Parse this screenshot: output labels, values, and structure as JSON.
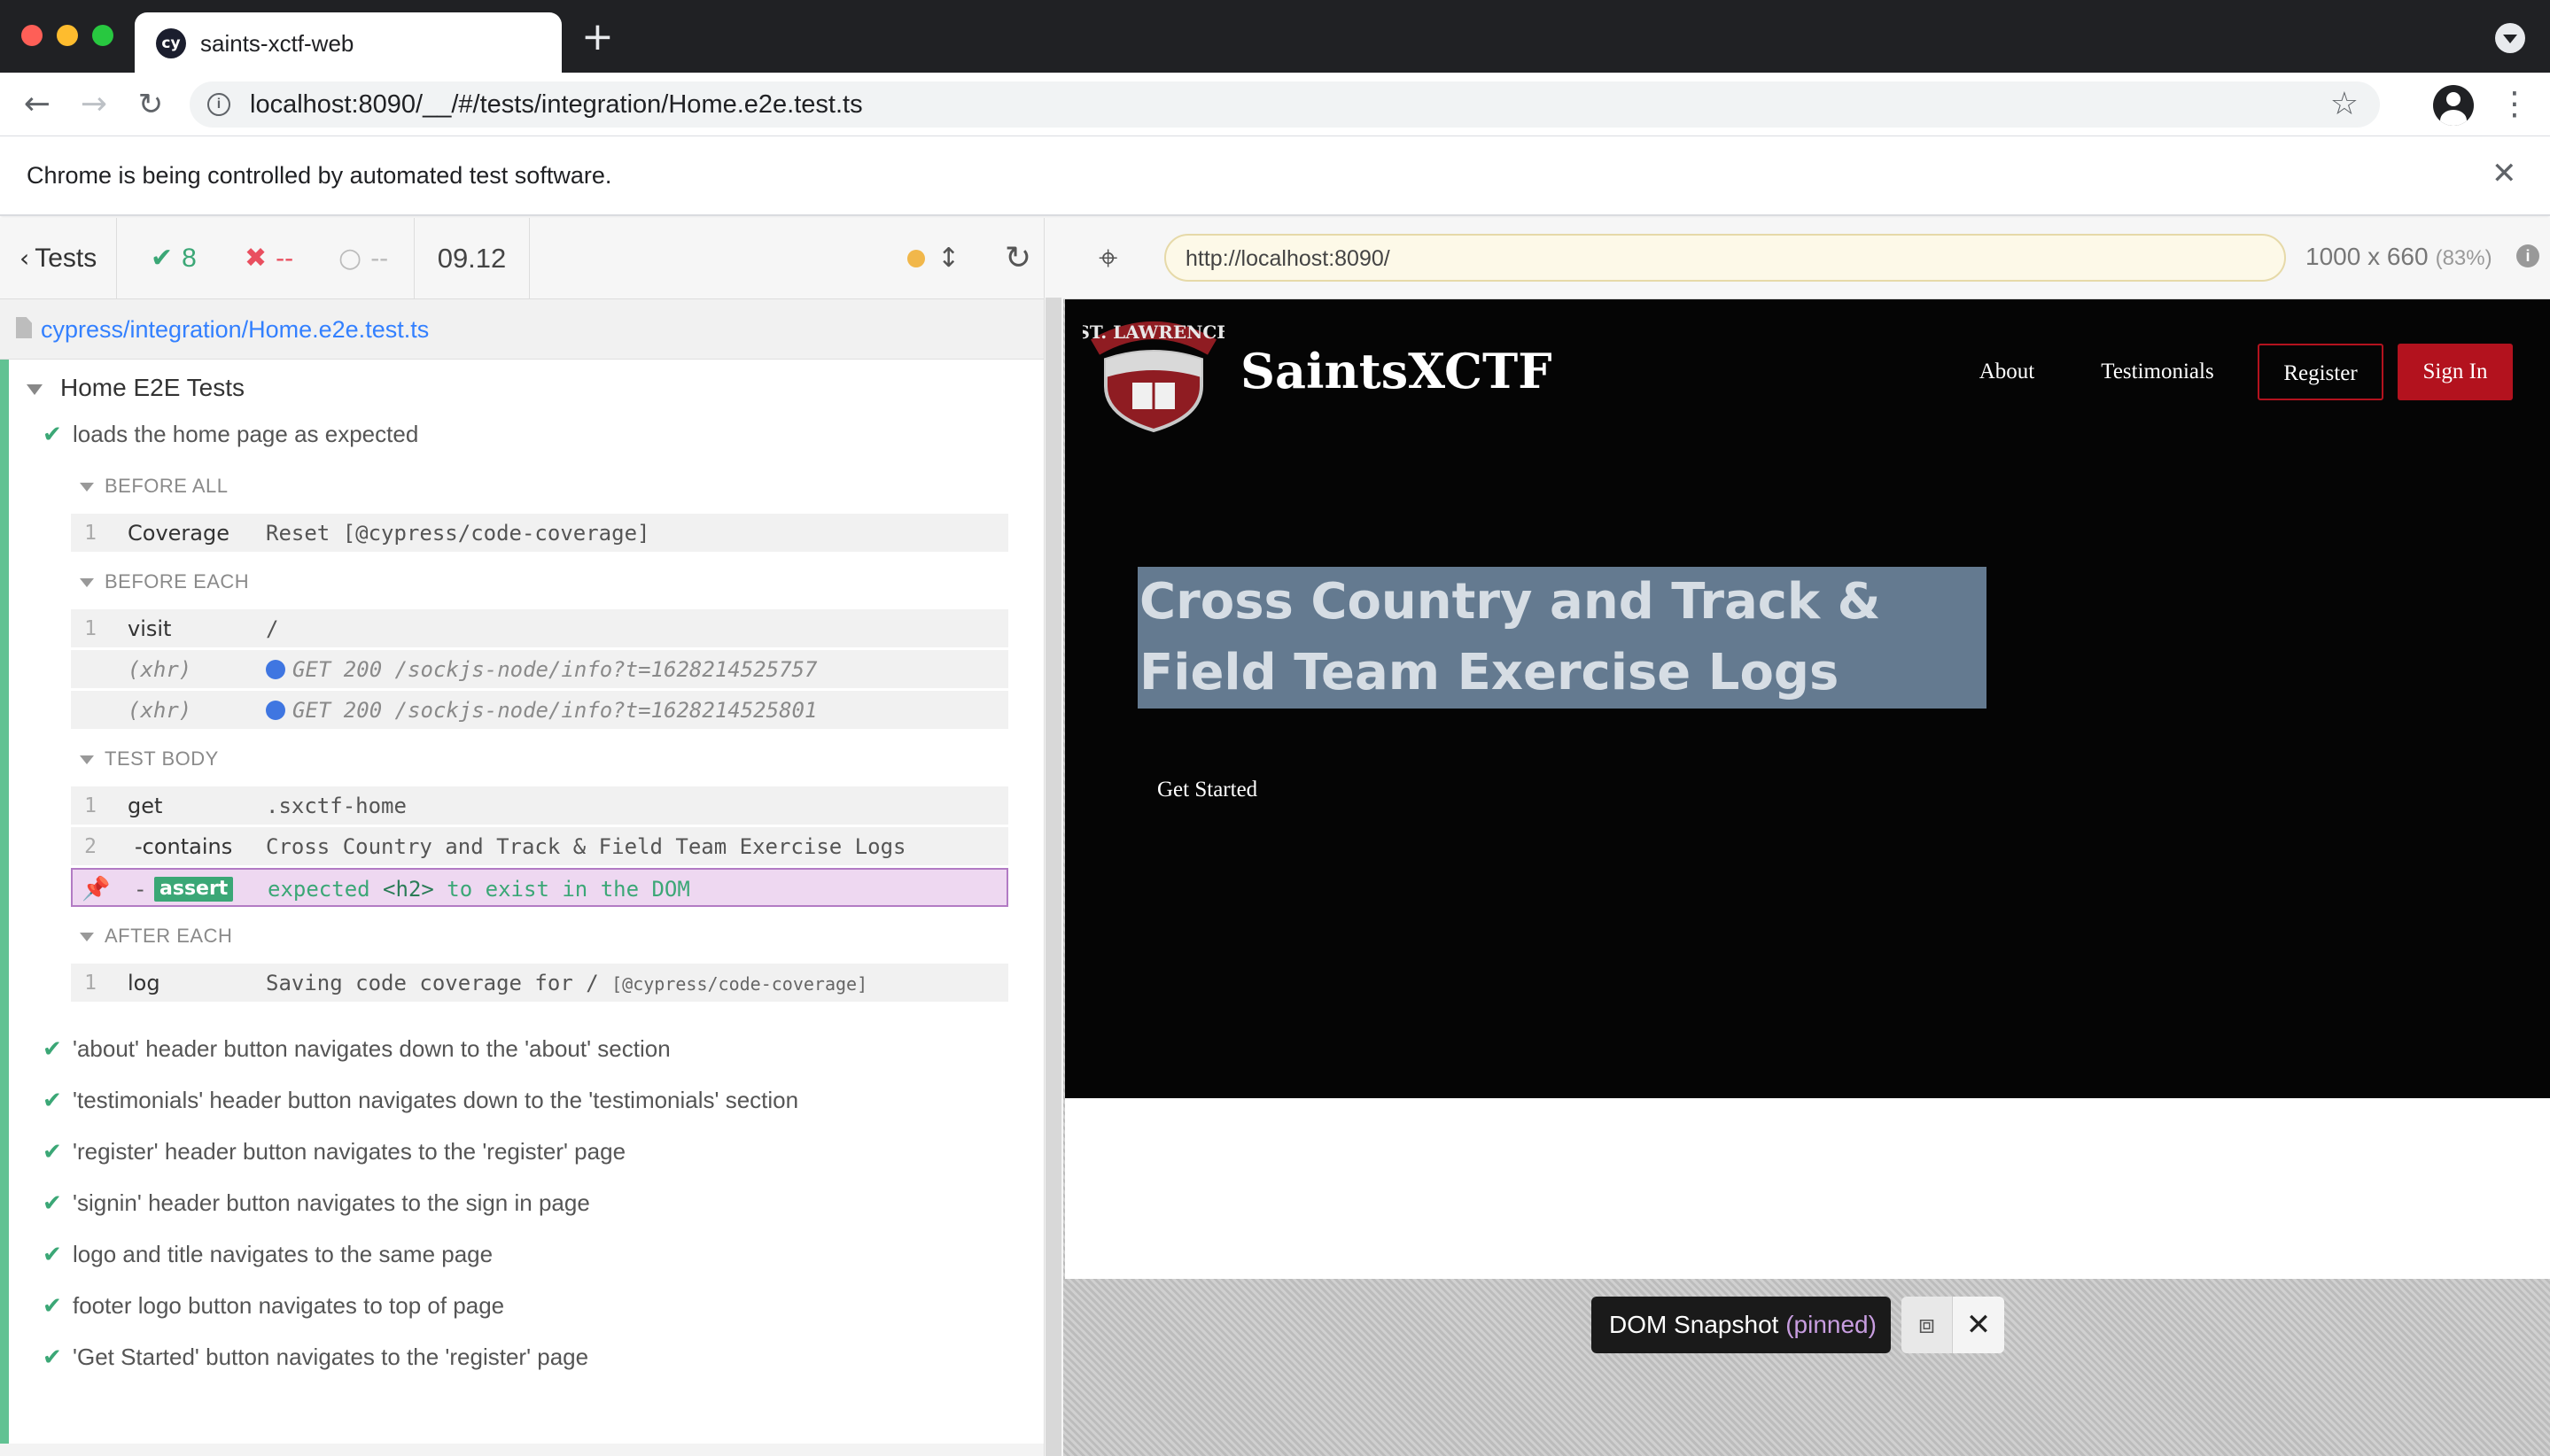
{
  "browser": {
    "tab_title": "saints-xctf-web",
    "tab_favicon": "cy",
    "url": "localhost:8090/__/#/tests/integration/Home.e2e.test.ts",
    "infobar_text": "Chrome is being controlled by automated test software."
  },
  "reporter": {
    "tests_label": "Tests",
    "passed": "8",
    "failed": "--",
    "pending": "--",
    "duration": "09.12",
    "spec_path": "cypress/integration/Home.e2e.test.ts",
    "suite_title": "Home E2E Tests",
    "current_test": "loads the home page as expected",
    "hooks": [
      {
        "title": "BEFORE ALL",
        "commands": [
          {
            "num": "1",
            "name": "Coverage",
            "message": "Reset [@cypress/code-coverage]"
          }
        ]
      },
      {
        "title": "BEFORE EACH",
        "commands": [
          {
            "num": "1",
            "name": "visit",
            "message": "/"
          },
          {
            "num": "",
            "name": "(xhr)",
            "message": "GET 200 /sockjs-node/info?t=1628214525757"
          },
          {
            "num": "",
            "name": "(xhr)",
            "message": "GET 200 /sockjs-node/info?t=1628214525801"
          }
        ]
      },
      {
        "title": "TEST BODY",
        "commands": [
          {
            "num": "1",
            "name": "get",
            "message": ".sxctf-home"
          },
          {
            "num": "2",
            "name": "-contains",
            "message": "Cross Country and Track & Field Team Exercise Logs"
          },
          {
            "num": "",
            "name": "assert",
            "message_prefix": "expected",
            "message_el": "<h2>",
            "message_suffix": "to exist in the DOM"
          }
        ]
      },
      {
        "title": "AFTER EACH",
        "commands": [
          {
            "num": "1",
            "name": "log",
            "message": "Saving code coverage for /",
            "message_tag": "[@cypress/code-coverage]"
          }
        ]
      }
    ],
    "other_tests": [
      "'about' header button navigates down to the 'about' section",
      "'testimonials' header button navigates down to the 'testimonials' section",
      "'register' header button navigates to the 'register' page",
      "'signin' header button navigates to the sign in page",
      "logo and title navigates to the same page",
      "footer logo button navigates to top of page",
      "'Get Started' button navigates to the 'register' page"
    ]
  },
  "aut": {
    "url": "http://localhost:8090/",
    "viewport": "1000 x 660",
    "scale": "(83%)",
    "site": {
      "logo_text": "ST. LAWRENCE",
      "title": "SaintsXCTF",
      "nav": {
        "about": "About",
        "testimonials": "Testimonials",
        "register": "Register",
        "signin": "Sign In"
      },
      "hero_heading": "Cross Country and Track & Field Team Exercise Logs",
      "cta": "Get Started"
    },
    "snapshot": {
      "label": "DOM Snapshot",
      "pinned": "(pinned)"
    }
  },
  "colors": {
    "pass": "#3ba776",
    "fail": "#e94f5f",
    "brand_red": "#b3121e",
    "pinned_bg": "#eed8f1"
  }
}
